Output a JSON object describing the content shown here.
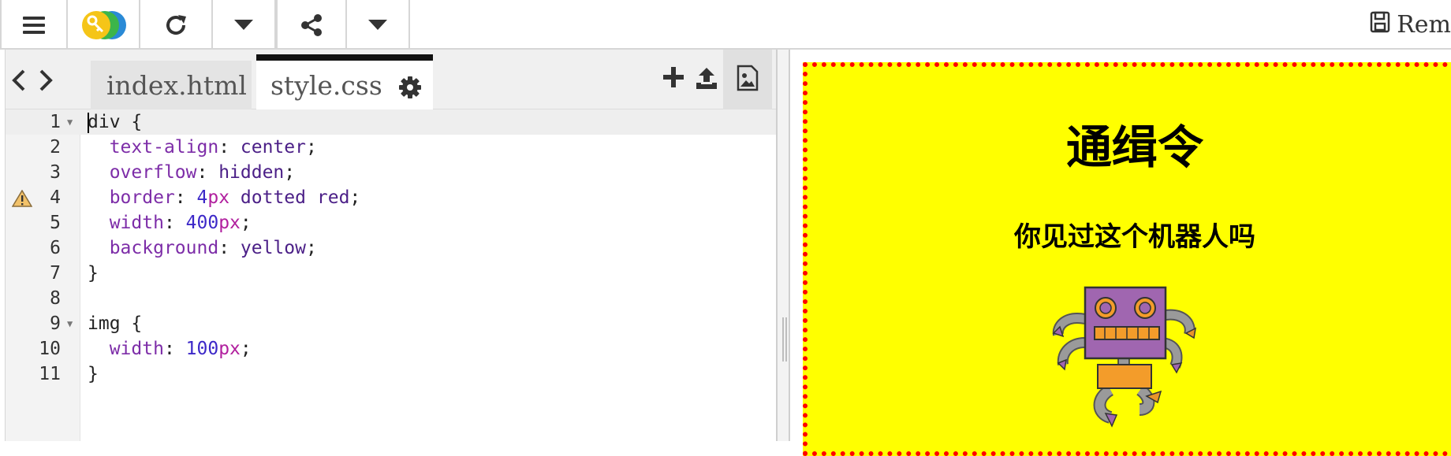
{
  "toolbar": {
    "menu_icon": "hamburger-menu-icon",
    "logo_icon": "trinket-key-logo-icon",
    "refresh_icon": "refresh-icon",
    "run_menu_icon": "chevron-down-icon",
    "share_icon": "share-icon",
    "share_menu_icon": "chevron-down-icon",
    "remix_label": "Rem",
    "remix_icon": "save-icon"
  },
  "editor": {
    "tabs": [
      {
        "label": "index.html",
        "active": false
      },
      {
        "label": "style.css",
        "active": true
      }
    ],
    "icons": {
      "back": "chevron-left-icon",
      "forward": "chevron-right-icon",
      "tab_settings": "gear-icon",
      "add_file": "plus-icon",
      "upload": "upload-icon",
      "images": "image-icon"
    },
    "lines": [
      {
        "num": "1",
        "text": "div {",
        "fold": true,
        "warning": false
      },
      {
        "num": "2",
        "text": "  text-align: center;",
        "fold": false,
        "warning": false
      },
      {
        "num": "3",
        "text": "  overflow: hidden;",
        "fold": false,
        "warning": false
      },
      {
        "num": "4",
        "text": "  border: 4px dotted red;",
        "fold": false,
        "warning": true
      },
      {
        "num": "5",
        "text": "  width: 400px;",
        "fold": false,
        "warning": false
      },
      {
        "num": "6",
        "text": "  background: yellow;",
        "fold": false,
        "warning": false
      },
      {
        "num": "7",
        "text": "}",
        "fold": false,
        "warning": false
      },
      {
        "num": "8",
        "text": "",
        "fold": false,
        "warning": false
      },
      {
        "num": "9",
        "text": "img {",
        "fold": true,
        "warning": false
      },
      {
        "num": "10",
        "text": "  width: 100px;",
        "fold": false,
        "warning": false
      },
      {
        "num": "11",
        "text": "}",
        "fold": false,
        "warning": false
      }
    ]
  },
  "preview": {
    "title": "通缉令",
    "subtitle": "你见过这个机器人吗",
    "image_icon": "robot-image",
    "background_color": "#ffff00",
    "border_color": "#ff0000"
  }
}
